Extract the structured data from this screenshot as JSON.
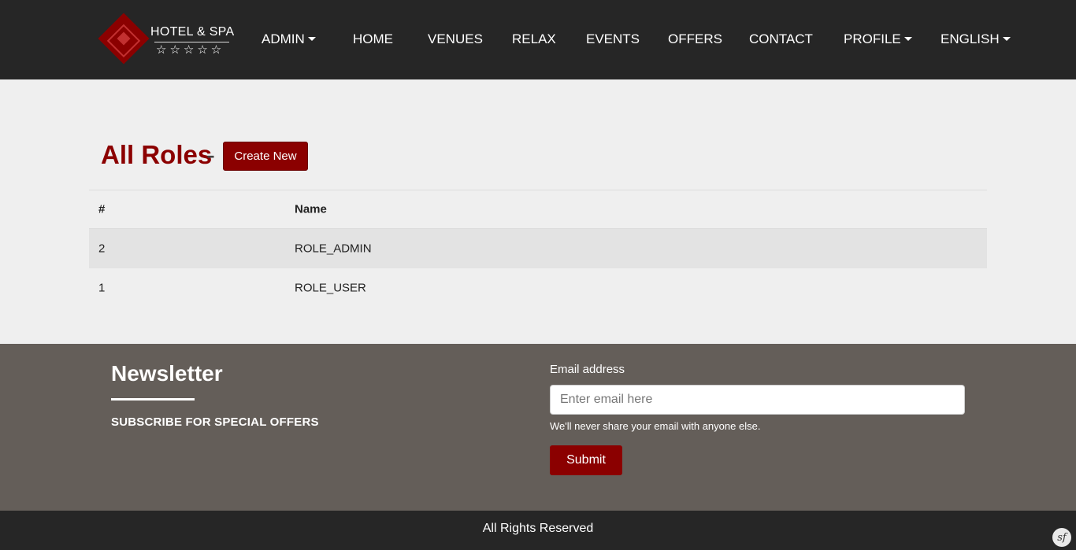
{
  "brand": {
    "name": "HOTEL & SPA",
    "stars": "☆☆☆☆☆"
  },
  "nav": {
    "admin": "ADMIN",
    "home": "HOME",
    "venues": "VENUES",
    "relax": "RELAX",
    "events": "EVENTS",
    "offers": "OFFERS",
    "contact": "CONTACT",
    "profile": "PROFILE",
    "language": "ENGLISH"
  },
  "main": {
    "title": "All Roles",
    "separator": "-",
    "create_label": "Create New",
    "table": {
      "headers": [
        "#",
        "Name"
      ],
      "rows": [
        {
          "id": "2",
          "name": "ROLE_ADMIN"
        },
        {
          "id": "1",
          "name": "ROLE_USER"
        }
      ]
    }
  },
  "newsletter": {
    "title": "Newsletter",
    "subtitle": "SUBSCRIBE FOR SPECIAL OFFERS",
    "email_label": "Email address",
    "email_placeholder": "Enter email here",
    "email_value": "",
    "help_text": "We'll never share your email with anyone else.",
    "submit_label": "Submit"
  },
  "footer": {
    "text": "All Rights Reserved",
    "symfony_badge": "sf"
  },
  "colors": {
    "accent": "#8b0000",
    "navbar": "#262626",
    "newsletter_bg": "#645e59"
  }
}
